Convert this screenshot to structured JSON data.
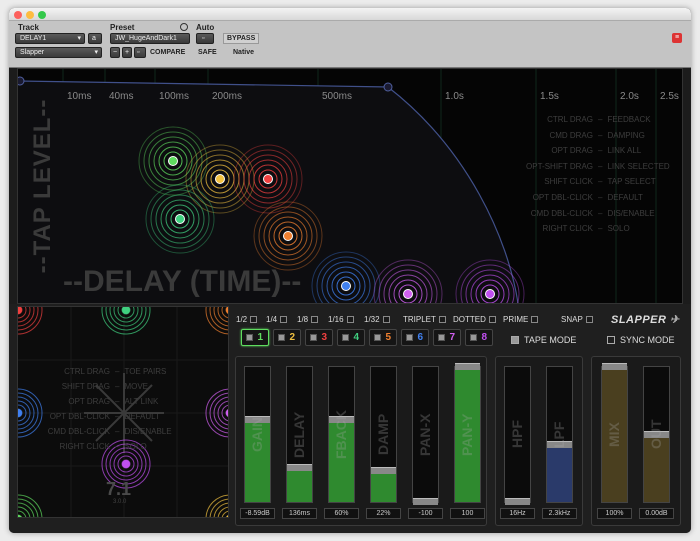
{
  "header": {
    "track_label": "Track",
    "track_name": "DELAY1",
    "track_mode": "a",
    "track_insert": "Slapper",
    "preset_label": "Preset",
    "preset_name": "JW_HugeAndDark1",
    "compare_label": "COMPARE",
    "auto_label": "Auto",
    "safe_label": "SAFE",
    "bypass_label": "BYPASS",
    "native_label": "Native",
    "nav_plus": "+",
    "nav_minus": "−"
  },
  "display": {
    "time_ticks": [
      "10ms",
      "40ms",
      "100ms",
      "200ms",
      "500ms",
      "1.0s",
      "1.5s",
      "2.0s",
      "2.5s"
    ],
    "y_label": "--TAP LEVEL--",
    "x_label": "--DELAY (TIME)--",
    "help": [
      {
        "action": "CTRL DRAG",
        "result": "FEEDBACK"
      },
      {
        "action": "CMD DRAG",
        "result": "DAMPING"
      },
      {
        "action": "OPT DRAG",
        "result": "LINK ALL"
      },
      {
        "action": "OPT-SHIFT DRAG",
        "result": "LINK SELECTED"
      },
      {
        "action": "SHIFT CLICK",
        "result": "TAP SELECT"
      },
      {
        "action": "OPT DBL-CLICK",
        "result": "DEFAULT"
      },
      {
        "action": "CMD DBL-CLICK",
        "result": "DIS/ENABLE"
      },
      {
        "action": "RIGHT CLICK",
        "result": "SOLO"
      }
    ]
  },
  "xy_pad": {
    "help": [
      {
        "action": "CTRL DRAG",
        "result": "TOE PAIRS"
      },
      {
        "action": "SHIFT DRAG",
        "result": "MOVE"
      },
      {
        "action": "OPT DRAG",
        "result": "ALT LINK"
      },
      {
        "action": "OPT DBL-CLICK",
        "result": "DEFAULT"
      },
      {
        "action": "CMD DBL-CLICK",
        "result": "DIS/ENABLE"
      },
      {
        "action": "RIGHT CLICK",
        "result": "SOLO"
      }
    ],
    "watermark_number": "7.1",
    "watermark_sub": "3.0.0"
  },
  "timing": {
    "options": [
      "1/2",
      "1/4",
      "1/8",
      "1/16",
      "1/32",
      "TRIPLET",
      "DOTTED",
      "PRIME",
      "SNAP"
    ],
    "logo": "SLAPPER"
  },
  "taps": [
    {
      "label": "1",
      "color": "#5fdc5f"
    },
    {
      "label": "2",
      "color": "#f0c040"
    },
    {
      "label": "3",
      "color": "#f04040"
    },
    {
      "label": "4",
      "color": "#40d080"
    },
    {
      "label": "5",
      "color": "#f08030"
    },
    {
      "label": "6",
      "color": "#4080f0"
    },
    {
      "label": "7",
      "color": "#d060f0"
    },
    {
      "label": "8",
      "color": "#c050f0"
    }
  ],
  "modes": {
    "tape": "TAPE MODE",
    "sync": "SYNC MODE"
  },
  "faders": [
    {
      "label": "GAIN",
      "value": "-8.59dB",
      "level": 0.61,
      "fill": "#2f8a2f"
    },
    {
      "label": "DELAY",
      "value": "136ms",
      "level": 0.25,
      "fill": "#2f8a2f"
    },
    {
      "label": "FBACK",
      "value": "60%",
      "level": 0.61,
      "fill": "#2f8a2f"
    },
    {
      "label": "DAMP",
      "value": "22%",
      "level": 0.23,
      "fill": "#2f8a2f"
    },
    {
      "label": "PAN-X",
      "value": "-100",
      "level": 0.0,
      "fill": "#2f8a2f"
    },
    {
      "label": "PAN-Y",
      "value": "100",
      "level": 1.0,
      "fill": "#2f8a2f"
    },
    {
      "label": "HPF",
      "value": "16Hz",
      "level": 0.0,
      "fill": "#2a3a6a"
    },
    {
      "label": "LPF",
      "value": "2.3kHz",
      "level": 0.42,
      "fill": "#2a3a6a"
    },
    {
      "label": "MIX",
      "value": "100%",
      "level": 1.0,
      "fill": "#4a3f1f"
    },
    {
      "label": "OUT",
      "value": "0.00dB",
      "level": 0.5,
      "fill": "#4a3f1f"
    }
  ]
}
